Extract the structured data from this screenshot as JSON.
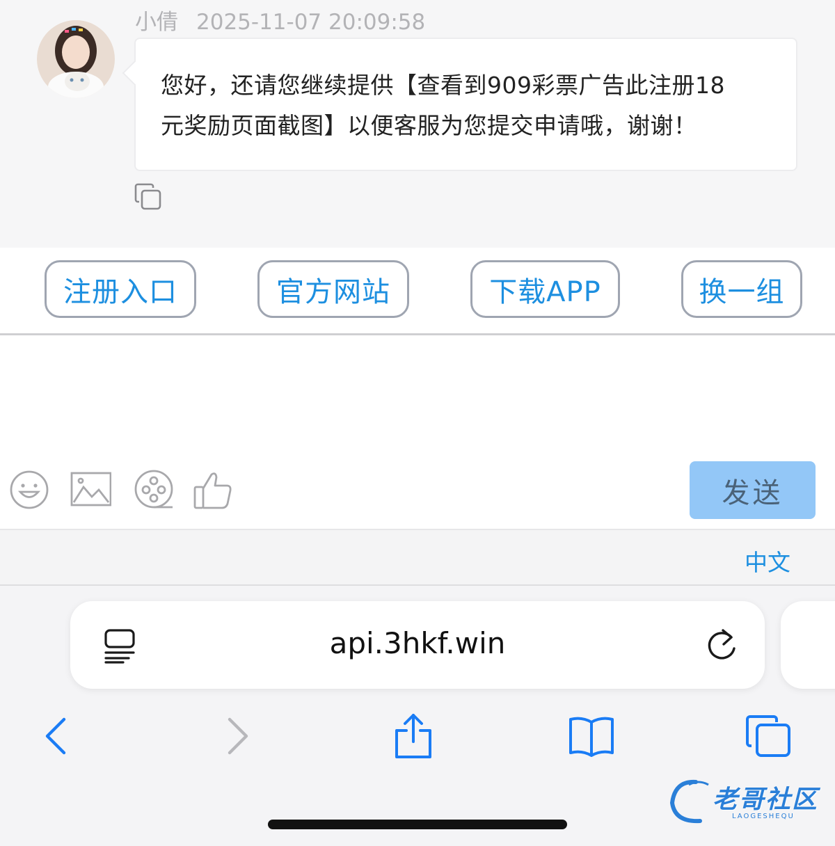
{
  "message": {
    "sender": "小倩",
    "timestamp": "2025-11-07 20:09:58",
    "text_line1": "您好，还请您继续提供【查看到909彩票广告此注册18",
    "text_line2": "元奖励页面截图】以便客服为您提交申请哦，谢谢！"
  },
  "quick_buttons": [
    "注册入口",
    "官方网站",
    "下载APP",
    "换一组"
  ],
  "input": {
    "value": "",
    "tools": [
      "emoji-icon",
      "image-icon",
      "video-icon",
      "thumbs-up-icon"
    ],
    "send_label": "发送"
  },
  "language": "中文",
  "browser": {
    "url": "api.3hkf.win",
    "nav": [
      "back-icon",
      "forward-icon",
      "share-icon",
      "bookmarks-icon",
      "tabs-icon"
    ]
  },
  "watermark": {
    "text": "老哥社区",
    "sub": "LAOGESHEQU"
  },
  "colors": {
    "accent": "#1d8fe0",
    "send_bg": "#93c7f7",
    "button_border": "#9fa5b1",
    "safari_blue": "#1a7cf5"
  }
}
